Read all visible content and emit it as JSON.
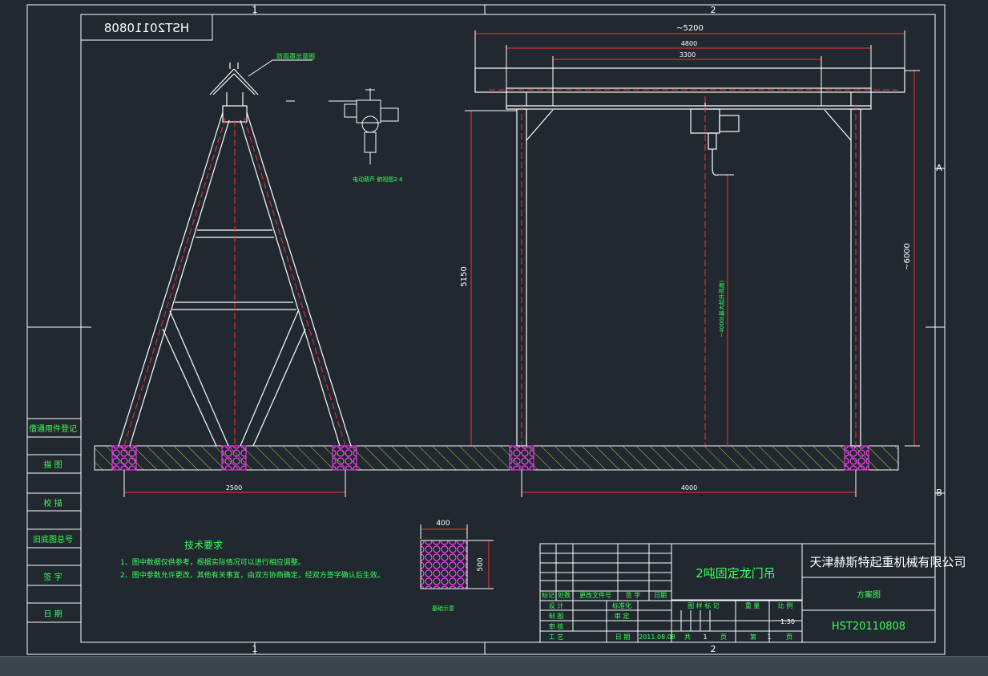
{
  "sheet": {
    "id_mirrored": "HST20110808",
    "zone_top_1": "1",
    "zone_top_2": "2",
    "zone_bottom_1": "1",
    "zone_bottom_2": "2",
    "zone_right_a": "A",
    "zone_right_b": "B"
  },
  "left_column": {
    "items": [
      {
        "label": "借通用件登记"
      },
      {
        "label": "描 图"
      },
      {
        "label": "校 描"
      },
      {
        "label": "旧底图总号"
      },
      {
        "label": "签 字"
      },
      {
        "label": "日 期"
      }
    ]
  },
  "dimensions": {
    "width_total": "~5200",
    "width_4800": "4800",
    "width_3300": "3300",
    "height_5150": "5150",
    "height_6000": "~6000",
    "lift_height": "~4000(最大起升高度)",
    "base_2500": "2500",
    "base_4000": "4000",
    "footing_400": "400",
    "footing_500": "500"
  },
  "annotations": {
    "roof_label": "防雨罩示意图",
    "hoist_label": "电动葫芦 俯视图2:4",
    "footing_label": "基础示意"
  },
  "notes": {
    "title": "技术要求",
    "line1": "1、图中数据仅供参考，根据实际情况可以进行相应调整。",
    "line2": "2、图中参数允许更改，其他有关事宜，由双方协商确定，经双方签字确认后生效。"
  },
  "title_block": {
    "drawing_title": "2吨固定龙门吊",
    "company": "天津赫斯特起重机械有限公司",
    "drawing_type": "方案图",
    "drawing_no": "HST20110808",
    "rev_h1": "标记",
    "rev_h2": "处数",
    "rev_h3": "更改文件号",
    "rev_h4": "签 字",
    "rev_h5": "日期",
    "design": "设 计",
    "draw": "制 图",
    "review": "审 核",
    "process": "工 艺",
    "standard": "标准化",
    "approve": "审 定",
    "date_label": "日 期",
    "date_value": "2011.08.08",
    "stage_label": "图 样 标 记",
    "weight_label": "重 量",
    "scale_label": "比 例",
    "scale_value": "1:30",
    "total_label": "共",
    "total_value": "1",
    "page_unit": "页",
    "sheet_label": "第",
    "sheet_value": "1",
    "sheet_unit": "页"
  }
}
